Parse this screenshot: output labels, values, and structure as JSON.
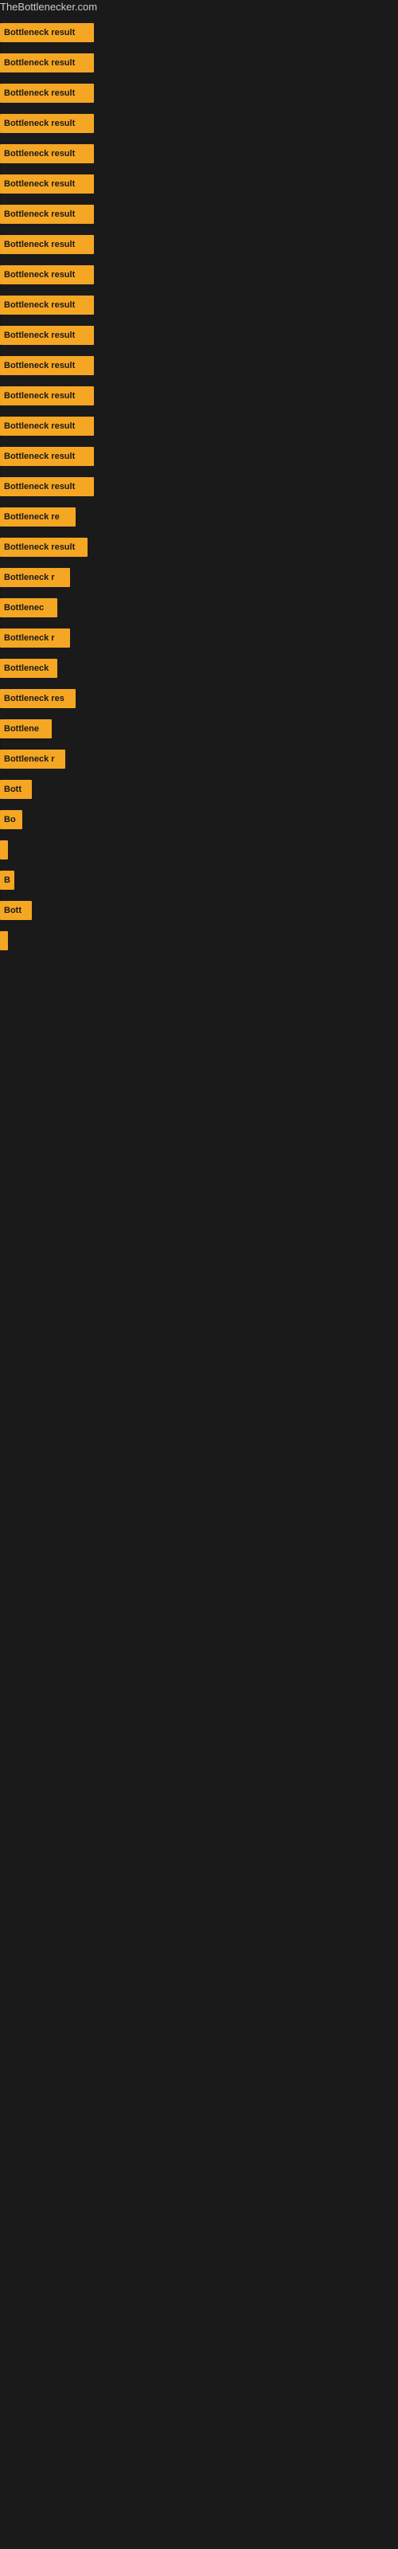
{
  "site": {
    "title": "TheBottlenecker.com"
  },
  "bars": [
    {
      "label": "Bottleneck result",
      "width": 118
    },
    {
      "label": "Bottleneck result",
      "width": 118
    },
    {
      "label": "Bottleneck result",
      "width": 118
    },
    {
      "label": "Bottleneck result",
      "width": 118
    },
    {
      "label": "Bottleneck result",
      "width": 118
    },
    {
      "label": "Bottleneck result",
      "width": 118
    },
    {
      "label": "Bottleneck result",
      "width": 118
    },
    {
      "label": "Bottleneck result",
      "width": 118
    },
    {
      "label": "Bottleneck result",
      "width": 118
    },
    {
      "label": "Bottleneck result",
      "width": 118
    },
    {
      "label": "Bottleneck result",
      "width": 118
    },
    {
      "label": "Bottleneck result",
      "width": 118
    },
    {
      "label": "Bottleneck result",
      "width": 118
    },
    {
      "label": "Bottleneck result",
      "width": 118
    },
    {
      "label": "Bottleneck result",
      "width": 118
    },
    {
      "label": "Bottleneck result",
      "width": 118
    },
    {
      "label": "Bottleneck re",
      "width": 95
    },
    {
      "label": "Bottleneck result",
      "width": 110
    },
    {
      "label": "Bottleneck r",
      "width": 88
    },
    {
      "label": "Bottlenec",
      "width": 72
    },
    {
      "label": "Bottleneck r",
      "width": 88
    },
    {
      "label": "Bottleneck",
      "width": 72
    },
    {
      "label": "Bottleneck res",
      "width": 95
    },
    {
      "label": "Bottlene",
      "width": 65
    },
    {
      "label": "Bottleneck r",
      "width": 82
    },
    {
      "label": "Bott",
      "width": 40
    },
    {
      "label": "Bo",
      "width": 28
    },
    {
      "label": "",
      "width": 4
    },
    {
      "label": "B",
      "width": 18
    },
    {
      "label": "Bott",
      "width": 40
    },
    {
      "label": "",
      "width": 4
    }
  ]
}
